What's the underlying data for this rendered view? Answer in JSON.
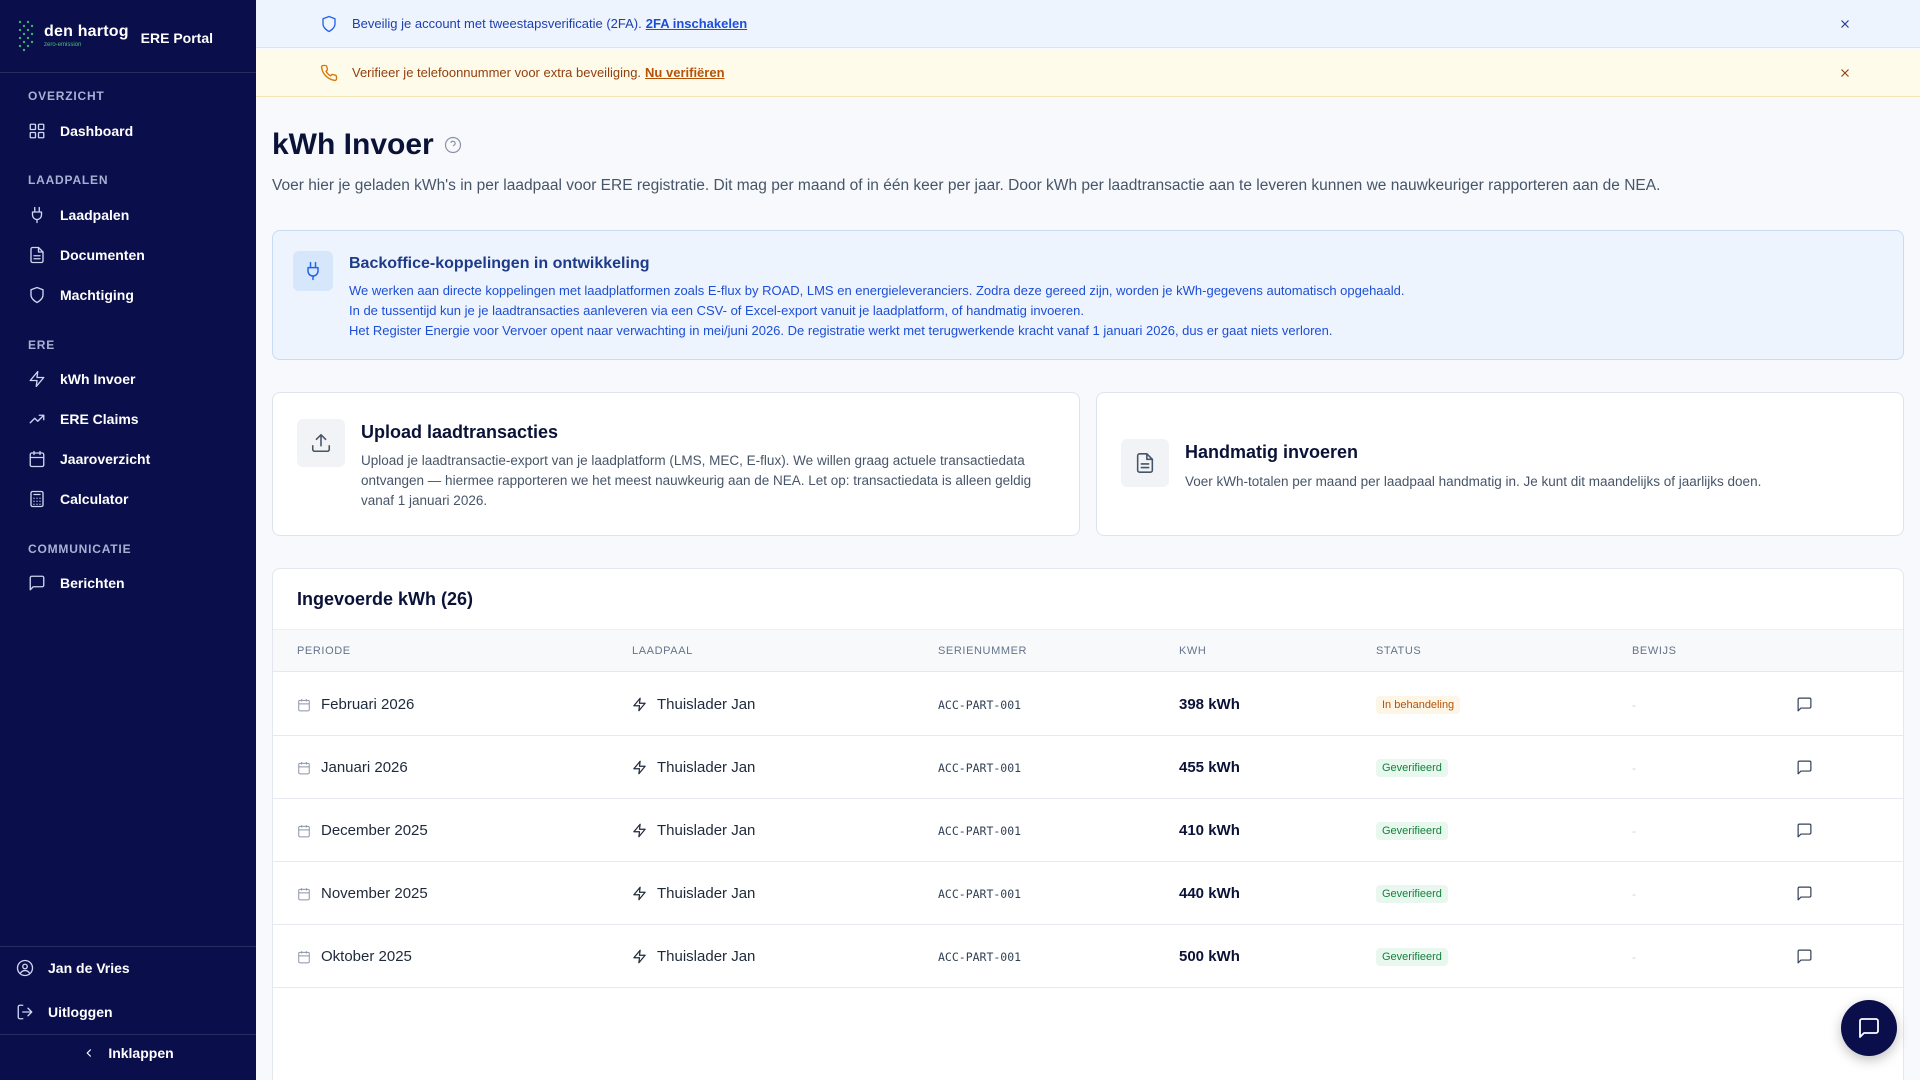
{
  "sidebar": {
    "brand_name": "den hartog",
    "brand_sub": "zero-emission",
    "portal_label": "ERE Portal",
    "sections": {
      "overzicht": "OVERZICHT",
      "laadpalen": "LAADPALEN",
      "ere": "ERE",
      "communicatie": "COMMUNICATIE"
    },
    "items": {
      "dashboard": "Dashboard",
      "laadpalen": "Laadpalen",
      "documenten": "Documenten",
      "machtiging": "Machtiging",
      "kwh_invoer": "kWh Invoer",
      "ere_claims": "ERE Claims",
      "jaaroverzicht": "Jaaroverzicht",
      "calculator": "Calculator",
      "berichten": "Berichten"
    },
    "user_name": "Jan de Vries",
    "logout": "Uitloggen",
    "collapse": "Inklappen"
  },
  "banners": {
    "twofa_text": "Beveilig je account met tweestapsverificatie (2FA).",
    "twofa_link": "2FA inschakelen",
    "phone_text": "Verifieer je telefoonnummer voor extra beveiliging.",
    "phone_link": "Nu verifiëren"
  },
  "page": {
    "title": "kWh Invoer",
    "description": "Voer hier je geladen kWh's in per laadpaal voor ERE registratie. Dit mag per maand of in één keer per jaar. Door kWh per laadtransactie aan te leveren kunnen we nauwkeuriger rapporteren aan de NEA."
  },
  "info": {
    "title": "Backoffice-koppelingen in ontwikkeling",
    "line1": "We werken aan directe koppelingen met laadplatformen zoals E-flux by ROAD, LMS en energieleveranciers. Zodra deze gereed zijn, worden je kWh-gegevens automatisch opgehaald.",
    "line2": "In de tussentijd kun je je laadtransacties aanleveren via een CSV- of Excel-export vanuit je laadplatform, of handmatig invoeren.",
    "line3": "Het Register Energie voor Vervoer opent naar verwachting in mei/juni 2026. De registratie werkt met terugwerkende kracht vanaf 1 januari 2026, dus er gaat niets verloren."
  },
  "cards": {
    "upload_title": "Upload laadtransacties",
    "upload_desc_1": "Upload je laadtransactie-export van je laadplatform (LMS, MEC, E-flux). We willen graag actuele transactiedata",
    "upload_desc_2": "ontvangen — hiermee rapporteren we het meest nauwkeurig aan de NEA. Let op: transactiedata is alleen geldig",
    "upload_desc_3": "vanaf 1 januari 2026.",
    "manual_title": "Handmatig invoeren",
    "manual_desc": "Voer kWh-totalen per maand per laadpaal handmatig in. Je kunt dit maandelijks of jaarlijks doen."
  },
  "table": {
    "title": "Ingevoerde kWh (26)",
    "headers": {
      "periode": "PERIODE",
      "laadpaal": "LAADPAAL",
      "serienummer": "SERIENUMMER",
      "kwh": "KWH",
      "status": "STATUS",
      "bewijs": "BEWIJS"
    },
    "rows": [
      {
        "periode": "Februari 2026",
        "laadpaal": "Thuislader Jan",
        "serienummer": "ACC-PART-001",
        "kwh": "398 kWh",
        "status": "In behandeling",
        "bewijs": "-"
      },
      {
        "periode": "Januari 2026",
        "laadpaal": "Thuislader Jan",
        "serienummer": "ACC-PART-001",
        "kwh": "455 kWh",
        "status": "Geverifieerd",
        "bewijs": "-"
      },
      {
        "periode": "December 2025",
        "laadpaal": "Thuislader Jan",
        "serienummer": "ACC-PART-001",
        "kwh": "410 kWh",
        "status": "Geverifieerd",
        "bewijs": "-"
      },
      {
        "periode": "November 2025",
        "laadpaal": "Thuislader Jan",
        "serienummer": "ACC-PART-001",
        "kwh": "440 kWh",
        "status": "Geverifieerd",
        "bewijs": "-"
      },
      {
        "periode": "Oktober 2025",
        "laadpaal": "Thuislader Jan",
        "serienummer": "ACC-PART-001",
        "kwh": "500 kWh",
        "status": "Geverifieerd",
        "bewijs": "-"
      }
    ]
  },
  "colors": {
    "sidebar_bg": "#0a0e4a",
    "accent_blue": "#2563eb",
    "status_pending": "#b45309",
    "status_verified": "#15803d"
  },
  "icons": {
    "nav": [
      "grid-icon",
      "plug-icon",
      "document-icon",
      "shield-icon",
      "bolt-icon",
      "trending-up-icon",
      "calendar-icon",
      "calculator-icon",
      "message-icon"
    ],
    "chat_fab": "chat-icon"
  }
}
